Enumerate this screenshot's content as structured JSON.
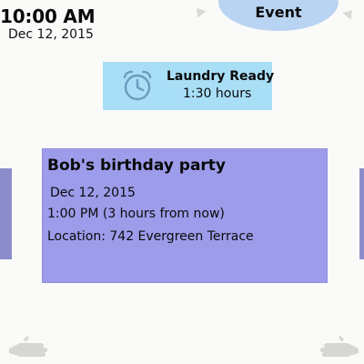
{
  "clock": {
    "time": "10:00 AM",
    "date": "Dec 12, 2015"
  },
  "top_pill": {
    "label": "Event"
  },
  "notification": {
    "title": "Laundry Ready",
    "time": "1:30 hours",
    "icon": "alarm-clock-icon"
  },
  "event": {
    "title": "Bob's birthday party",
    "date": "Dec 12, 2015",
    "time": "1:00 PM (3 hours from now)",
    "location": "Location: 742 Evergreen Terrace"
  },
  "colors": {
    "background": "#fafaf8",
    "notification_bg": "#a9def7",
    "event_card_bg": "#9d9ceb",
    "pill_bg": "#b9d3f2",
    "edge": "#8b8ccb",
    "icon_stroke": "#6a9cbd",
    "gesture_icon": "#d6d6d3"
  }
}
